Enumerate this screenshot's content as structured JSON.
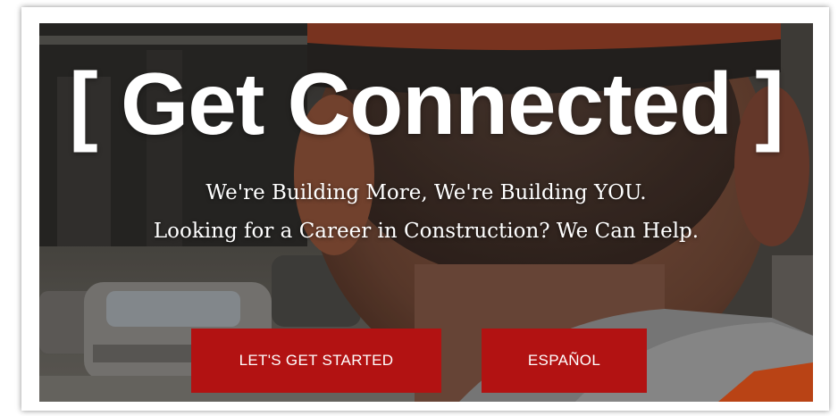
{
  "hero": {
    "headline": "[ Get Connected ]",
    "tagline_1": "We're Building More, We're Building YOU.",
    "tagline_2": "Looking for a Career in Construction? We Can Help."
  },
  "buttons": {
    "start_label": "LET'S GET STARTED",
    "spanish_label": "ESPAÑOL"
  },
  "colors": {
    "button_bg": "#b21212",
    "text": "#ffffff",
    "vest_orange": "#e2521a"
  }
}
